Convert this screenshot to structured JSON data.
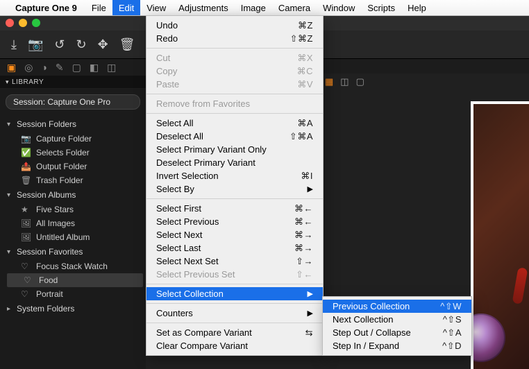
{
  "menubar": {
    "app_name": "Capture One 9",
    "items": [
      "File",
      "Edit",
      "View",
      "Adjustments",
      "Image",
      "Camera",
      "Window",
      "Scripts",
      "Help"
    ],
    "active": "Edit"
  },
  "library": {
    "header": "LIBRARY",
    "session_pill": "Session: Capture One Pro",
    "groups": [
      {
        "title": "Session Folders",
        "items": [
          {
            "icon": "📷",
            "label": "Capture Folder"
          },
          {
            "icon": "✅",
            "label": "Selects Folder"
          },
          {
            "icon": "📤",
            "label": "Output Folder"
          },
          {
            "icon": "🗑",
            "label": "Trash Folder"
          }
        ]
      },
      {
        "title": "Session Albums",
        "items": [
          {
            "icon": "★",
            "label": "Five Stars"
          },
          {
            "icon": "🖼",
            "label": "All Images"
          },
          {
            "icon": "🖼",
            "label": "Untitled Album"
          }
        ]
      },
      {
        "title": "Session Favorites",
        "items": [
          {
            "icon": "♡",
            "label": "Focus Stack Watch"
          },
          {
            "icon": "♡",
            "label": "Food",
            "selected": true
          },
          {
            "icon": "♡",
            "label": "Portrait"
          }
        ]
      },
      {
        "title": "System Folders",
        "collapsed": true,
        "items": []
      }
    ]
  },
  "edit_menu": [
    {
      "label": "Undo",
      "shortcut": "⌘Z"
    },
    {
      "label": "Redo",
      "shortcut": "⇧⌘Z"
    },
    {
      "sep": true
    },
    {
      "label": "Cut",
      "shortcut": "⌘X",
      "disabled": true
    },
    {
      "label": "Copy",
      "shortcut": "⌘C",
      "disabled": true
    },
    {
      "label": "Paste",
      "shortcut": "⌘V",
      "disabled": true
    },
    {
      "sep": true
    },
    {
      "label": "Remove from Favorites",
      "disabled": true
    },
    {
      "sep": true
    },
    {
      "label": "Select All",
      "shortcut": "⌘A"
    },
    {
      "label": "Deselect All",
      "shortcut": "⇧⌘A"
    },
    {
      "label": "Select Primary Variant Only"
    },
    {
      "label": "Deselect Primary Variant"
    },
    {
      "label": "Invert Selection",
      "shortcut": "⌘I"
    },
    {
      "label": "Select By",
      "submenu": true
    },
    {
      "sep": true
    },
    {
      "label": "Select First",
      "shortcut": "⌘←"
    },
    {
      "label": "Select Previous",
      "shortcut": "⌘←"
    },
    {
      "label": "Select Next",
      "shortcut": "⌘→"
    },
    {
      "label": "Select Last",
      "shortcut": "⌘→"
    },
    {
      "label": "Select Next Set",
      "shortcut": "⇧→"
    },
    {
      "label": "Select Previous Set",
      "shortcut": "⇧←",
      "disabled": true
    },
    {
      "sep": true
    },
    {
      "label": "Select Collection",
      "submenu": true,
      "highlight": true
    },
    {
      "sep": true
    },
    {
      "label": "Counters",
      "submenu": true
    },
    {
      "sep": true
    },
    {
      "label": "Set as Compare Variant",
      "shortcut": "⇆"
    },
    {
      "label": "Clear Compare Variant"
    }
  ],
  "select_collection_submenu": [
    {
      "label": "Previous Collection",
      "shortcut": "^⇧W",
      "highlight": true
    },
    {
      "label": "Next Collection",
      "shortcut": "^⇧S"
    },
    {
      "label": "Step Out / Collapse",
      "shortcut": "^⇧A"
    },
    {
      "label": "Step In / Expand",
      "shortcut": "^⇧D"
    }
  ]
}
